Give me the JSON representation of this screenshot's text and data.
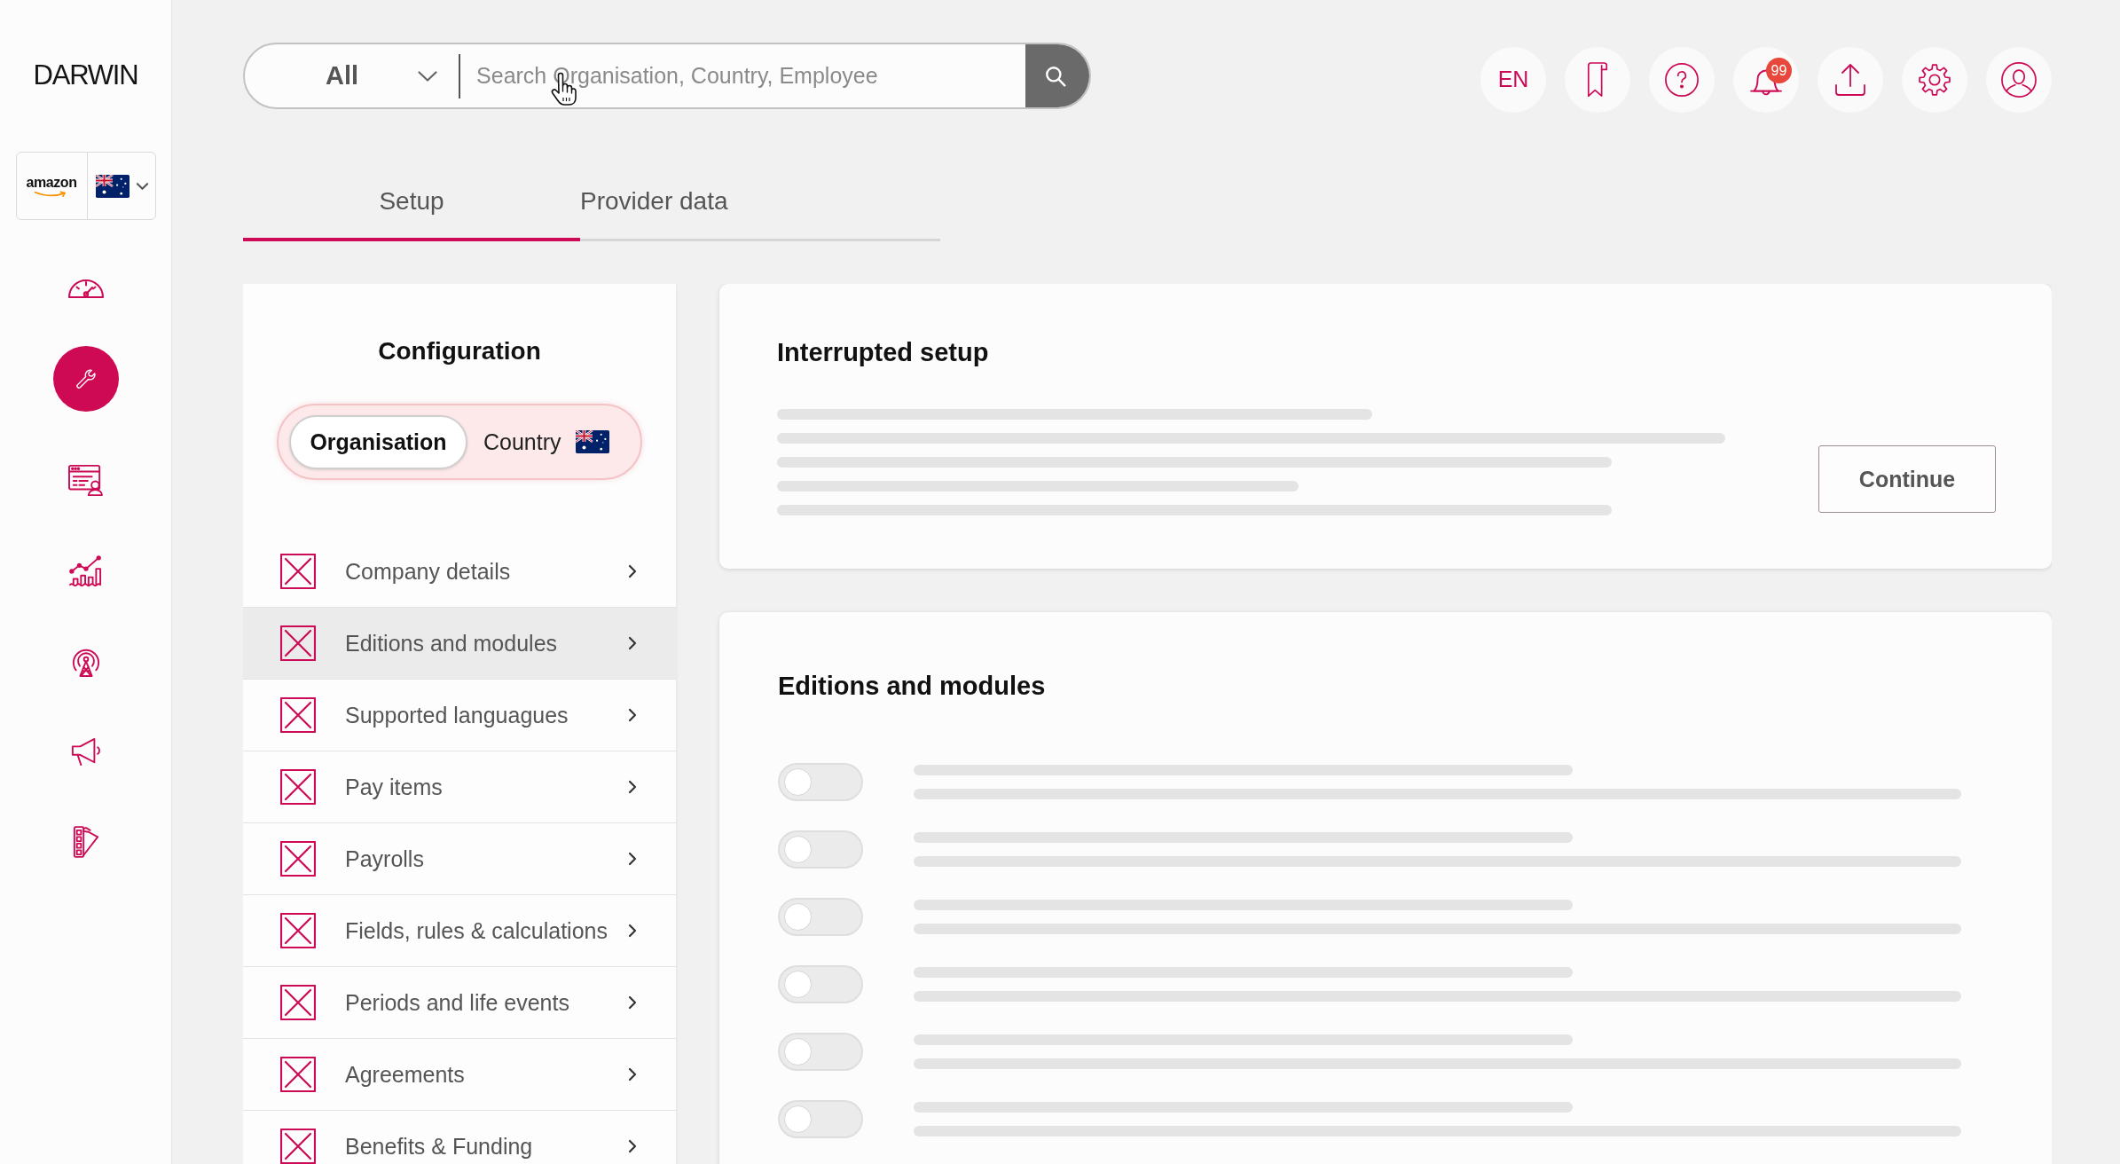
{
  "sidebar": {
    "logo": "DARWIN",
    "organisation": {
      "name": "amazon"
    },
    "nav_items": [
      {
        "selected": false
      },
      {
        "selected": true
      },
      {
        "selected": false
      },
      {
        "selected": false
      },
      {
        "selected": false
      },
      {
        "selected": false
      },
      {
        "selected": false
      }
    ]
  },
  "search": {
    "scope": "All",
    "placeholder": "Search Organisation, Country, Employee"
  },
  "toolbar": {
    "language": "EN",
    "notification_count": "99"
  },
  "tabs": [
    {
      "label": "Setup",
      "selected": true
    },
    {
      "label": "Provider data",
      "selected": false
    }
  ],
  "configuration": {
    "title": "Configuration",
    "scope_switch": [
      {
        "label": "Organisation",
        "selected": true
      },
      {
        "label": "Country",
        "selected": false
      }
    ],
    "items": [
      {
        "label": "Company details",
        "completed": false,
        "selected": false
      },
      {
        "label": "Editions and modules",
        "completed": false,
        "selected": true
      },
      {
        "label": "Supported languagues",
        "completed": false,
        "selected": false
      },
      {
        "label": "Pay items",
        "completed": false,
        "selected": false
      },
      {
        "label": "Payrolls",
        "completed": false,
        "selected": false
      },
      {
        "label": "Fields, rules & calculations",
        "completed": false,
        "selected": false
      },
      {
        "label": "Periods and life events",
        "completed": false,
        "selected": false
      },
      {
        "label": "Agreements",
        "completed": false,
        "selected": false
      },
      {
        "label": "Benefits & Funding",
        "completed": false,
        "selected": false
      }
    ]
  },
  "interrupted_setup": {
    "title": "Interrupted setup",
    "button": "Continue"
  },
  "editions_and_modules": {
    "title": "Editions and modules",
    "modules": [
      {
        "on": false
      },
      {
        "on": false
      },
      {
        "on": false
      },
      {
        "on": false
      },
      {
        "on": false
      },
      {
        "on": false
      }
    ]
  }
}
